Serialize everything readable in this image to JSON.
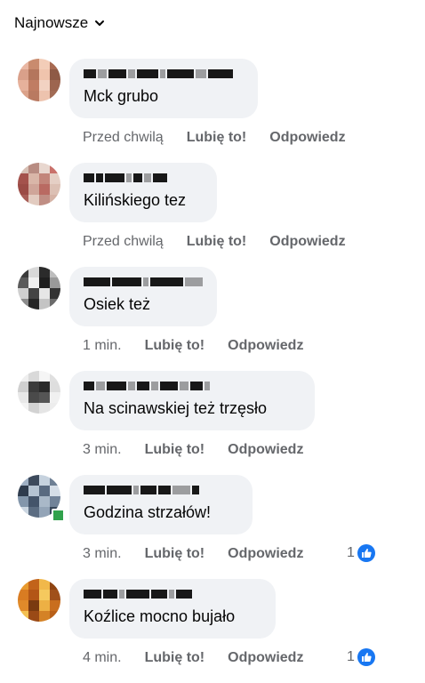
{
  "sort": {
    "label": "Najnowsze"
  },
  "actions": {
    "like": "Lubię to!",
    "reply": "Odpowiedz"
  },
  "comments": [
    {
      "text": "Mck grubo",
      "time": "Przed chwilą",
      "reactions": null,
      "avatar_colors": [
        "#e9b7a3",
        "#c98b6e",
        "#f3cdb8",
        "#a86a52",
        "#d9a08a",
        "#b4765d",
        "#f0c4ad",
        "#8e5a46",
        "#e6b19b",
        "#c07d63",
        "#f2d2c2",
        "#9d654f",
        "#dba28a",
        "#b97a61",
        "#edc3ae",
        "#a26b55"
      ]
    },
    {
      "text": "Kilińskiego tez",
      "time": "Przed chwilą",
      "reactions": null,
      "avatar_colors": [
        "#d7c0b5",
        "#b88c82",
        "#e8d7cf",
        "#c9716b",
        "#a4524c",
        "#d9b6a8",
        "#c2857a",
        "#e5cfc5",
        "#9b4b45",
        "#cfa599",
        "#b96a62",
        "#dcc0b4",
        "#a85e57",
        "#e2cbc0",
        "#c08e84",
        "#d5b3a6"
      ]
    },
    {
      "text": "Osiek też",
      "time": "1 min.",
      "reactions": null,
      "avatar_colors": [
        "#3a3a3a",
        "#d8d8d8",
        "#2b2b2b",
        "#bdbdbd",
        "#5a5a5a",
        "#f0f0f0",
        "#1f1f1f",
        "#9a9a9a",
        "#cfcfcf",
        "#444444",
        "#e6e6e6",
        "#333333",
        "#8c8c8c",
        "#262626",
        "#c4c4c4",
        "#6b6b6b"
      ]
    },
    {
      "text": "Na scinawskiej też trzęsło",
      "time": "3 min.",
      "reactions": null,
      "avatar_colors": [
        "#efefef",
        "#d9d9d9",
        "#f5f5f5",
        "#e0e0e0",
        "#cfcfcf",
        "#3b3b3b",
        "#2a2a2a",
        "#dedede",
        "#e8e8e8",
        "#4a4a4a",
        "#555555",
        "#f0f0f0",
        "#f3f3f3",
        "#d2d2d2",
        "#e5e5e5",
        "#ededed"
      ]
    },
    {
      "text": "Godzina strzałów!",
      "time": "3 min.",
      "reactions": "1",
      "online": true,
      "avatar_colors": [
        "#9fb0c4",
        "#3d4a5c",
        "#c6d2de",
        "#6d7f94",
        "#2e3b4d",
        "#b5c3d2",
        "#596a80",
        "#d5dee8",
        "#8396ab",
        "#44546a",
        "#a9b8c8",
        "#718399",
        "#cbd6e1",
        "#5c6d82",
        "#93a4b7",
        "#38475a"
      ]
    },
    {
      "text": "Koźlice mocno bujało",
      "time": "4 min.",
      "reactions": "1",
      "avatar_colors": [
        "#e89a2e",
        "#c2631a",
        "#f1b84a",
        "#8f4412",
        "#d97c22",
        "#b35616",
        "#f5c95e",
        "#a0501a",
        "#e08a2a",
        "#7a3a10",
        "#edb044",
        "#c96e1e",
        "#f3c052",
        "#9a4a16",
        "#d48226",
        "#b86018"
      ]
    }
  ],
  "author_blocks": [
    [
      [
        14,
        1
      ],
      [
        10,
        0
      ],
      [
        20,
        1
      ],
      [
        8,
        0
      ],
      [
        24,
        1
      ],
      [
        6,
        0
      ],
      [
        30,
        1
      ],
      [
        12,
        0
      ],
      [
        28,
        1
      ]
    ],
    [
      [
        12,
        1
      ],
      [
        8,
        1
      ],
      [
        22,
        1
      ],
      [
        6,
        0
      ],
      [
        10,
        1
      ],
      [
        8,
        0
      ],
      [
        16,
        1
      ]
    ],
    [
      [
        30,
        1
      ],
      [
        34,
        1
      ],
      [
        6,
        0
      ],
      [
        38,
        1
      ],
      [
        20,
        0
      ]
    ],
    [
      [
        12,
        1
      ],
      [
        10,
        0
      ],
      [
        22,
        1
      ],
      [
        8,
        0
      ],
      [
        14,
        1
      ],
      [
        8,
        0
      ],
      [
        20,
        1
      ],
      [
        10,
        0
      ],
      [
        14,
        1
      ],
      [
        6,
        0
      ]
    ],
    [
      [
        24,
        1
      ],
      [
        28,
        1
      ],
      [
        6,
        0
      ],
      [
        18,
        1
      ],
      [
        14,
        1
      ],
      [
        20,
        0
      ],
      [
        8,
        1
      ]
    ],
    [
      [
        20,
        1
      ],
      [
        16,
        1
      ],
      [
        6,
        0
      ],
      [
        26,
        1
      ],
      [
        18,
        1
      ],
      [
        6,
        0
      ],
      [
        18,
        1
      ]
    ]
  ]
}
